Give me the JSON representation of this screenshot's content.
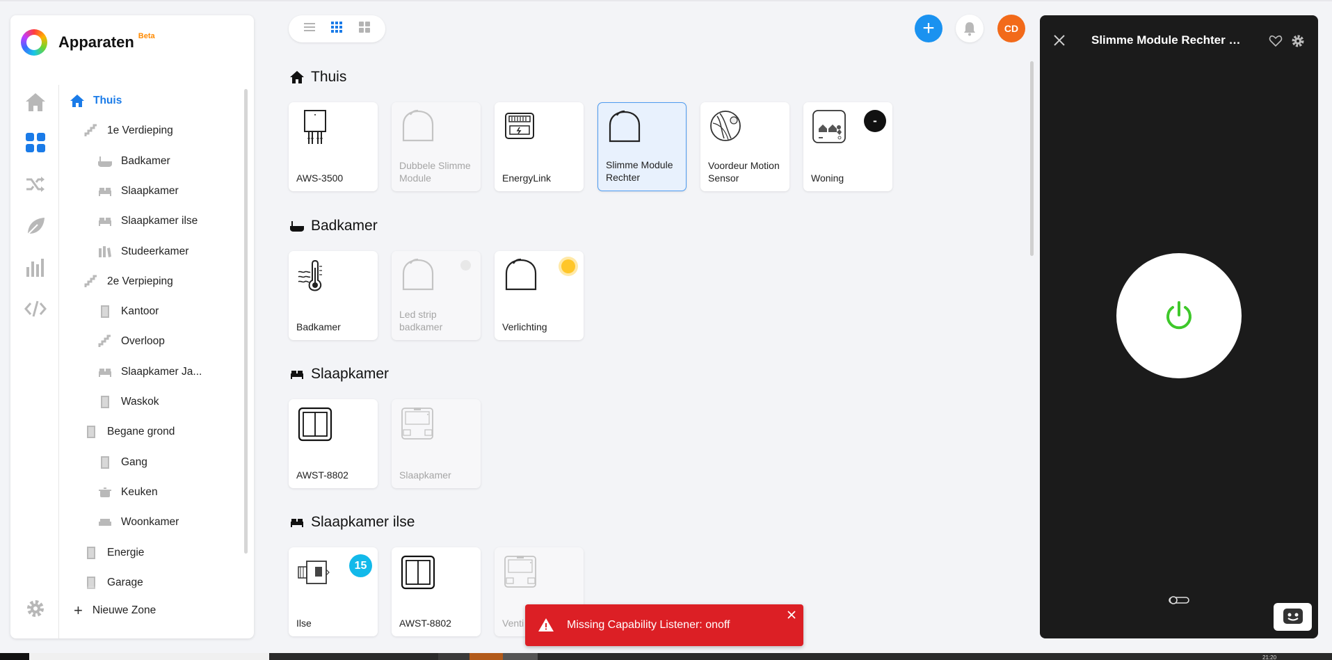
{
  "app": {
    "title": "Apparaten",
    "beta_label": "Beta"
  },
  "rail": {
    "icons": [
      "home-icon",
      "devices-grid-icon",
      "flows-shuffle-icon",
      "energy-leaf-icon",
      "insights-chart-icon",
      "developer-code-icon"
    ],
    "settings_icon": "gear-icon"
  },
  "zones_tree": {
    "items": [
      {
        "label": "Thuis",
        "level": 0,
        "icon": "home-icon",
        "active": true
      },
      {
        "label": "1e Verdieping",
        "level": 1,
        "icon": "stairs-icon"
      },
      {
        "label": "Badkamer",
        "level": 2,
        "icon": "bathtub-icon"
      },
      {
        "label": "Slaapkamer",
        "level": 2,
        "icon": "bed-icon"
      },
      {
        "label": "Slaapkamer ilse",
        "level": 2,
        "icon": "bed-icon"
      },
      {
        "label": "Studeerkamer",
        "level": 2,
        "icon": "books-icon"
      },
      {
        "label": "2e Verpieping",
        "level": 1,
        "icon": "stairs-icon"
      },
      {
        "label": "Kantoor",
        "level": 2,
        "icon": "door-icon"
      },
      {
        "label": "Overloop",
        "level": 2,
        "icon": "stairs-icon"
      },
      {
        "label": "Slaapkamer Ja...",
        "level": 2,
        "icon": "bed-icon"
      },
      {
        "label": "Waskok",
        "level": 2,
        "icon": "door-icon"
      },
      {
        "label": "Begane grond",
        "level": 1,
        "icon": "door-icon"
      },
      {
        "label": "Gang",
        "level": 2,
        "icon": "door-icon"
      },
      {
        "label": "Keuken",
        "level": 2,
        "icon": "pot-icon"
      },
      {
        "label": "Woonkamer",
        "level": 2,
        "icon": "sofa-icon"
      },
      {
        "label": "Energie",
        "level": 1,
        "icon": "door-icon"
      },
      {
        "label": "Garage",
        "level": 1,
        "icon": "door-icon"
      }
    ],
    "new_zone_label": "Nieuwe Zone"
  },
  "header": {
    "view_modes": [
      "list-view-icon",
      "grid-view-icon",
      "large-grid-view-icon"
    ],
    "active_view": "grid-view-icon",
    "add_icon": "plus-icon",
    "notifications_icon": "bell-icon",
    "avatar_initials": "CD"
  },
  "zones": [
    {
      "name": "Thuis",
      "icon": "home-icon",
      "devices": [
        {
          "label": "AWS-3500",
          "icon": "socket-module-icon",
          "state": "normal"
        },
        {
          "label": "Dubbele Slimme Module",
          "icon": "module-dome-icon",
          "state": "unavailable"
        },
        {
          "label": "EnergyLink",
          "icon": "energy-meter-icon",
          "state": "normal"
        },
        {
          "label": "Slimme Module Rechter",
          "icon": "module-dome-icon",
          "state": "selected"
        },
        {
          "label": "Voordeur Motion Sensor",
          "icon": "motion-sensor-icon",
          "state": "normal"
        },
        {
          "label": "Woning",
          "icon": "home-alarm-icon",
          "state": "normal",
          "badge": "-"
        }
      ]
    },
    {
      "name": "Badkamer",
      "icon": "bathtub-icon",
      "devices": [
        {
          "label": "Badkamer",
          "icon": "thermometer-icon",
          "state": "normal"
        },
        {
          "label": "Led strip badkamer",
          "icon": "module-dome-icon",
          "state": "unavailable",
          "indicator": "off"
        },
        {
          "label": "Verlichting",
          "icon": "module-dome-icon",
          "state": "normal",
          "indicator": "on"
        }
      ]
    },
    {
      "name": "Slaapkamer",
      "icon": "bed-icon",
      "devices": [
        {
          "label": "AWST-8802",
          "icon": "double-switch-icon",
          "state": "normal"
        },
        {
          "label": "Slaapkamer",
          "icon": "wall-thermostat-icon",
          "state": "unavailable"
        }
      ]
    },
    {
      "name": "Slaapkamer ilse",
      "icon": "bed-icon",
      "devices": [
        {
          "label": "Ilse",
          "icon": "radiator-valve-icon",
          "state": "normal",
          "badge": "15"
        },
        {
          "label": "AWST-8802",
          "icon": "double-switch-icon",
          "state": "normal"
        },
        {
          "label": "Venti",
          "icon": "wall-thermostat-icon",
          "state": "unavailable"
        }
      ]
    }
  ],
  "toast": {
    "message": "Missing Capability Listener: onoff",
    "icon": "warning-icon",
    "color": "#dc1f25"
  },
  "device_panel": {
    "title": "Slimme Module Rechter Sch...",
    "close_icon": "close-icon",
    "favorite_icon": "heart-icon",
    "settings_icon": "gear-icon",
    "power_icon": "power-icon",
    "power_color": "#3ec82a",
    "toggle_icon": "toggle-icon",
    "chat_icon": "chat-bot-icon"
  },
  "taskbar": {
    "time": "21:20"
  },
  "colors": {
    "accent": "#1a7be8",
    "add_button": "#1a92f0",
    "avatar": "#f26a1a",
    "panel_bg": "#1b1b1b"
  }
}
